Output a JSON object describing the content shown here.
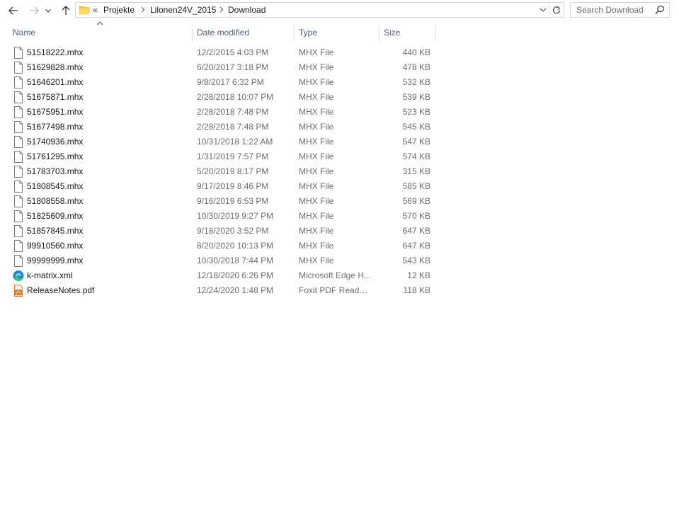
{
  "nav": {
    "back_icon": "arrow-left-icon",
    "forward_icon": "arrow-right-icon",
    "recent_icon": "chevron-down-icon",
    "up_icon": "arrow-up-icon"
  },
  "address": {
    "overflow": "«",
    "crumbs": [
      "Projekte",
      "Lilonen24V_2015",
      "Download"
    ],
    "dropdown_icon": "chevron-down-icon",
    "refresh_icon": "refresh-icon"
  },
  "search": {
    "placeholder": "Search Download",
    "icon": "magnifier-icon"
  },
  "columns": {
    "name": "Name",
    "date": "Date modified",
    "type": "Type",
    "size": "Size",
    "sort_icon": "sort-up-icon"
  },
  "files": [
    {
      "name": "51518222.mhx",
      "date": "12/2/2015 4:03 PM",
      "type": "MHX File",
      "size": "440 KB",
      "icon": "file"
    },
    {
      "name": "51629828.mhx",
      "date": "6/20/2017 3:18 PM",
      "type": "MHX File",
      "size": "478 KB",
      "icon": "file"
    },
    {
      "name": "51646201.mhx",
      "date": "9/8/2017 6:32 PM",
      "type": "MHX File",
      "size": "532 KB",
      "icon": "file"
    },
    {
      "name": "51675871.mhx",
      "date": "2/28/2018 10:07 PM",
      "type": "MHX File",
      "size": "539 KB",
      "icon": "file"
    },
    {
      "name": "51675951.mhx",
      "date": "2/28/2018 7:48 PM",
      "type": "MHX File",
      "size": "523 KB",
      "icon": "file"
    },
    {
      "name": "51677498.mhx",
      "date": "2/28/2018 7:48 PM",
      "type": "MHX File",
      "size": "545 KB",
      "icon": "file"
    },
    {
      "name": "51740936.mhx",
      "date": "10/31/2018 1:22 AM",
      "type": "MHX File",
      "size": "547 KB",
      "icon": "file"
    },
    {
      "name": "51761295.mhx",
      "date": "1/31/2019 7:57 PM",
      "type": "MHX File",
      "size": "574 KB",
      "icon": "file"
    },
    {
      "name": "51783703.mhx",
      "date": "5/20/2019 8:17 PM",
      "type": "MHX File",
      "size": "315 KB",
      "icon": "file"
    },
    {
      "name": "51808545.mhx",
      "date": "9/17/2019 8:46 PM",
      "type": "MHX File",
      "size": "585 KB",
      "icon": "file"
    },
    {
      "name": "51808558.mhx",
      "date": "9/16/2019 6:53 PM",
      "type": "MHX File",
      "size": "569 KB",
      "icon": "file"
    },
    {
      "name": "51825609.mhx",
      "date": "10/30/2019 9:27 PM",
      "type": "MHX File",
      "size": "570 KB",
      "icon": "file"
    },
    {
      "name": "51857845.mhx",
      "date": "9/18/2020 3:52 PM",
      "type": "MHX File",
      "size": "647 KB",
      "icon": "file"
    },
    {
      "name": "99910560.mhx",
      "date": "8/20/2020 10:13 PM",
      "type": "MHX File",
      "size": "647 KB",
      "icon": "file"
    },
    {
      "name": "99999999.mhx",
      "date": "10/30/2018 7:44 PM",
      "type": "MHX File",
      "size": "543 KB",
      "icon": "file"
    },
    {
      "name": "k-matrix.xml",
      "date": "12/18/2020 6:26 PM",
      "type": "Microsoft Edge H...",
      "size": "12 KB",
      "icon": "edge"
    },
    {
      "name": "ReleaseNotes.pdf",
      "date": "12/24/2020 1:48 PM",
      "type": "Foxit PDF Reader ...",
      "size": "118 KB",
      "icon": "pdf"
    }
  ],
  "colors": {
    "header_text": "#4c607a",
    "meta_text": "#6d6d6d",
    "folder_yellow": "#f5c842",
    "pdf_orange": "#e8772e",
    "edge_blue": "#1b8ad8",
    "edge_green": "#3ec16a"
  }
}
